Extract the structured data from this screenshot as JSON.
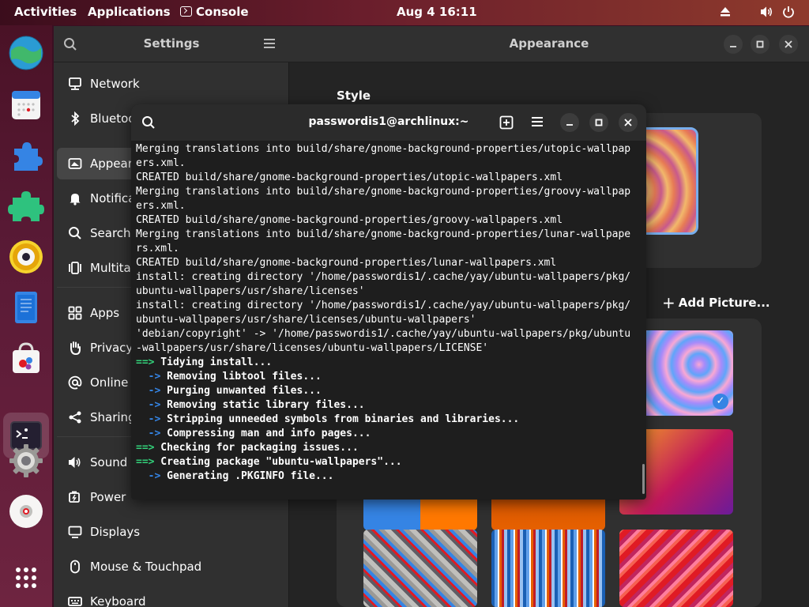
{
  "topbar": {
    "activities": "Activities",
    "applications": "Applications",
    "app_name": "Console",
    "datetime": "Aug 4  16:11"
  },
  "dock": {
    "items": [
      "browser-icon",
      "calendar-icon",
      "extensions-icon",
      "puzzle-icon",
      "rhythmbox-icon",
      "text-editor-icon",
      "software-store-icon",
      "terminal-icon",
      "settings-gear-icon",
      "disc-icon",
      "app-grid-icon"
    ]
  },
  "settings": {
    "sidebar_title": "Settings",
    "content_title": "Appearance",
    "sidebar_items": [
      {
        "label": "Network",
        "icon": "network-icon"
      },
      {
        "label": "Bluetooth",
        "icon": "bluetooth-icon"
      },
      {
        "label": "Appearance",
        "icon": "appearance-icon"
      },
      {
        "label": "Notifications",
        "icon": "bell-icon"
      },
      {
        "label": "Search",
        "icon": "search-icon"
      },
      {
        "label": "Multitasking",
        "icon": "multitasking-icon"
      },
      {
        "label": "Apps",
        "icon": "apps-icon"
      },
      {
        "label": "Privacy",
        "icon": "hand-icon"
      },
      {
        "label": "Online Accounts",
        "icon": "at-icon"
      },
      {
        "label": "Sharing",
        "icon": "share-icon"
      },
      {
        "label": "Sound",
        "icon": "speaker-icon"
      },
      {
        "label": "Power",
        "icon": "power-icon"
      },
      {
        "label": "Displays",
        "icon": "display-icon"
      },
      {
        "label": "Mouse & Touchpad",
        "icon": "mouse-icon"
      },
      {
        "label": "Keyboard",
        "icon": "keyboard-icon"
      }
    ],
    "style_label": "Style",
    "add_picture": "Add Picture..."
  },
  "terminal": {
    "title": "passwordis1@archlinux:~",
    "lines": [
      {
        "kind": "plain",
        "text": "Merging translations into build/share/gnome-background-properties/utopic-wallpap"
      },
      {
        "kind": "plain",
        "text": "ers.xml."
      },
      {
        "kind": "plain",
        "text": "CREATED build/share/gnome-background-properties/utopic-wallpapers.xml"
      },
      {
        "kind": "plain",
        "text": "Merging translations into build/share/gnome-background-properties/groovy-wallpap"
      },
      {
        "kind": "plain",
        "text": "ers.xml."
      },
      {
        "kind": "plain",
        "text": "CREATED build/share/gnome-background-properties/groovy-wallpapers.xml"
      },
      {
        "kind": "plain",
        "text": "Merging translations into build/share/gnome-background-properties/lunar-wallpape"
      },
      {
        "kind": "plain",
        "text": "rs.xml."
      },
      {
        "kind": "plain",
        "text": "CREATED build/share/gnome-background-properties/lunar-wallpapers.xml"
      },
      {
        "kind": "plain",
        "text": "install: creating directory '/home/passwordis1/.cache/yay/ubuntu-wallpapers/pkg/"
      },
      {
        "kind": "plain",
        "text": "ubuntu-wallpapers/usr/share/licenses'"
      },
      {
        "kind": "plain",
        "text": "install: creating directory '/home/passwordis1/.cache/yay/ubuntu-wallpapers/pkg/"
      },
      {
        "kind": "plain",
        "text": "ubuntu-wallpapers/usr/share/licenses/ubuntu-wallpapers'"
      },
      {
        "kind": "plain",
        "text": "'debian/copyright' -> '/home/passwordis1/.cache/yay/ubuntu-wallpapers/pkg/ubuntu"
      },
      {
        "kind": "plain",
        "text": "-wallpapers/usr/share/licenses/ubuntu-wallpapers/LICENSE'"
      },
      {
        "kind": "main",
        "prefix": "==>",
        "text": " Tidying install..."
      },
      {
        "kind": "sub",
        "prefix": "  ->",
        "text": " Removing libtool files..."
      },
      {
        "kind": "sub",
        "prefix": "  ->",
        "text": " Purging unwanted files..."
      },
      {
        "kind": "sub",
        "prefix": "  ->",
        "text": " Removing static library files..."
      },
      {
        "kind": "sub",
        "prefix": "  ->",
        "text": " Stripping unneeded symbols from binaries and libraries..."
      },
      {
        "kind": "sub",
        "prefix": "  ->",
        "text": " Compressing man and info pages..."
      },
      {
        "kind": "main",
        "prefix": "==>",
        "text": " Checking for packaging issues..."
      },
      {
        "kind": "main",
        "prefix": "==>",
        "text": " Creating package \"ubuntu-wallpapers\"..."
      },
      {
        "kind": "sub",
        "prefix": "  ->",
        "text": " Generating .PKGINFO file..."
      }
    ]
  },
  "colors": {
    "accent": "#3584e4",
    "terminal_green": "#33d17a",
    "terminal_blue": "#3584e4"
  }
}
